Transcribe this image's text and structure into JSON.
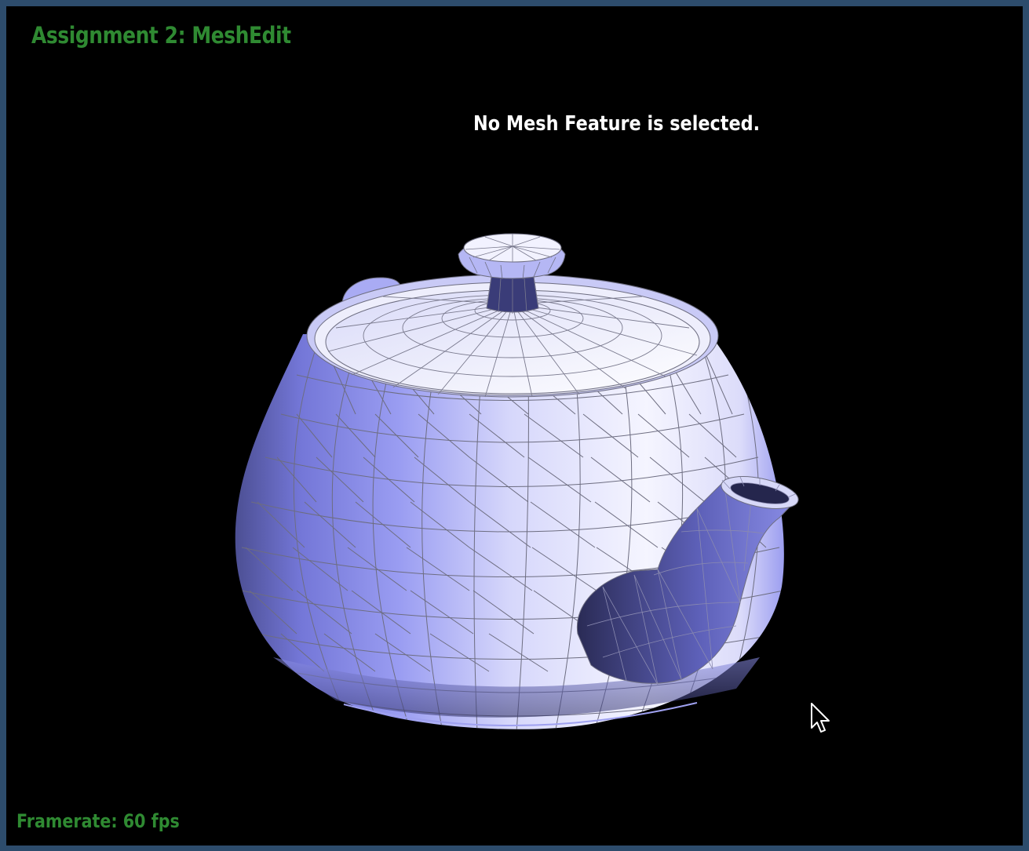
{
  "app": {
    "title": "Assignment 2: MeshEdit"
  },
  "status": {
    "message": "No Mesh Feature is selected."
  },
  "footer": {
    "framerate": "Framerate: 60 fps"
  },
  "colors": {
    "title": "#2f8a32",
    "background": "#000000",
    "border": "#2d4c6c",
    "mesh_light": "#f4f4ff",
    "mesh_mid": "#a8aaf4",
    "mesh_dark": "#4a4c8e",
    "wireframe": "#6d6d80"
  },
  "icons": {
    "cursor": "mouse-pointer-icon"
  }
}
